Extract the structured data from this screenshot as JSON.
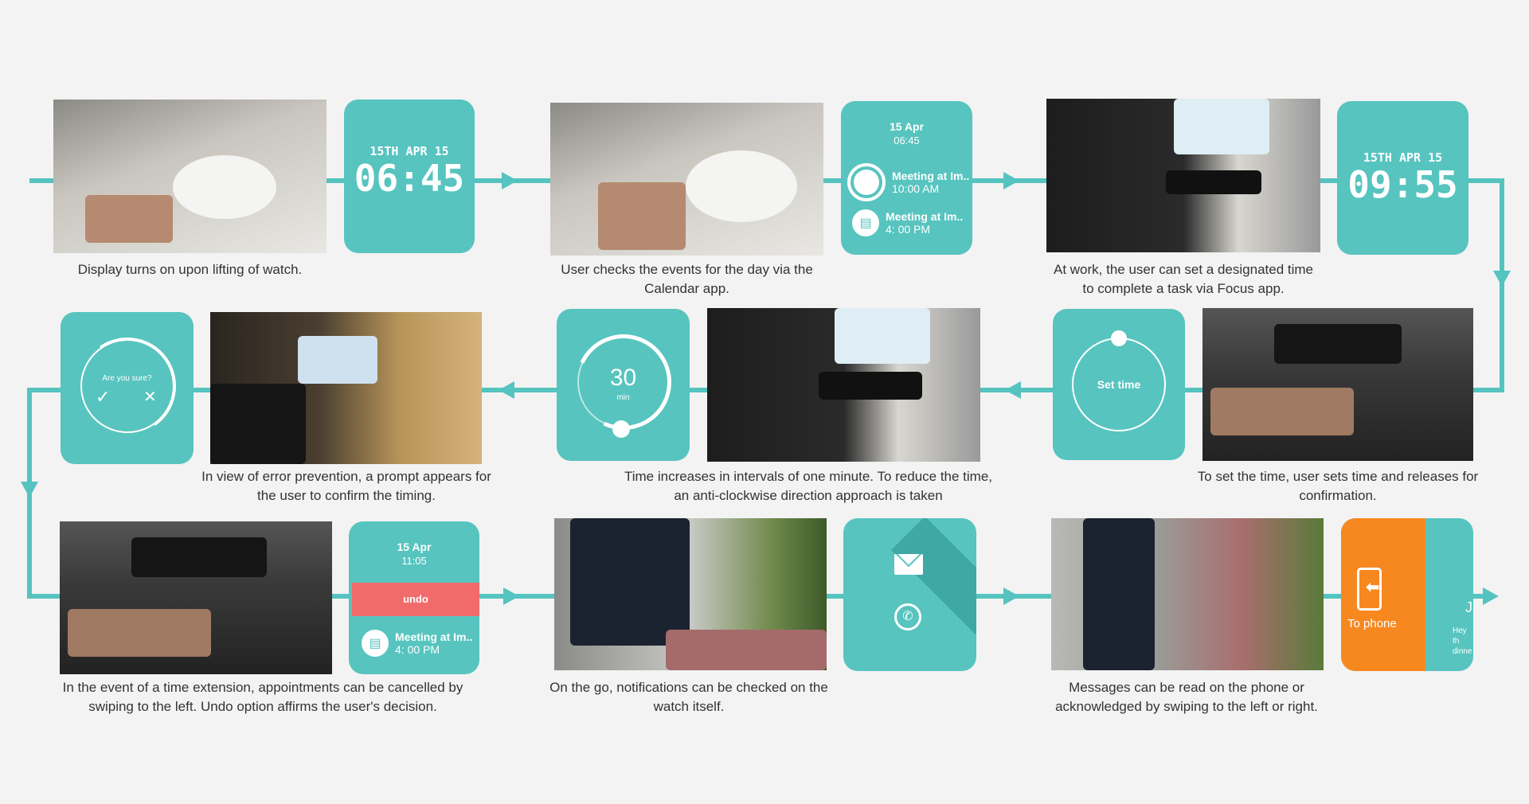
{
  "steps": [
    {
      "caption": "Display turns on upon lifting of watch.",
      "watch": {
        "date": "15TH APR 15",
        "time": "06:45"
      }
    },
    {
      "caption": "User checks the events for the day via the Calendar app.",
      "watch": {
        "date": "15 Apr",
        "time": "06:45",
        "events": [
          {
            "title": "Meeting at Im..",
            "time": "10:00 AM",
            "icon": "circle-icon"
          },
          {
            "title": "Meeting at Im..",
            "time": "4: 00 PM",
            "icon": "calendar-icon"
          }
        ]
      }
    },
    {
      "caption": "At work, the user can set a designated time to complete a task via Focus app.",
      "watch": {
        "date": "15TH APR 15",
        "time": "09:55"
      }
    },
    {
      "caption": "To set the time, user sets time and releases for confirmation.",
      "watch": {
        "label": "Set time"
      }
    },
    {
      "caption": "Time increases in intervals of one minute. To reduce the time, an anti-clockwise direction approach is taken",
      "watch": {
        "value": "30",
        "unit": "min"
      }
    },
    {
      "caption": "In view of error prevention, a prompt appears for the user to confirm the timing.",
      "watch": {
        "prompt": "Are you sure?",
        "confirm": "✓",
        "cancel": "✕"
      }
    },
    {
      "caption": "In the event of a time extension, appointments can be cancelled by swiping to the left. Undo option affirms the user's decision.",
      "watch": {
        "date": "15 Apr",
        "time": "11:05",
        "undo": "undo",
        "event": {
          "title": "Meeting at Im..",
          "time": "4: 00 PM"
        }
      }
    },
    {
      "caption": "On the go, notifications can be checked on the watch itself.",
      "watch": {
        "icons": [
          "mail-icon",
          "whatsapp-icon"
        ]
      }
    },
    {
      "caption": "Messages can be read on the phone or acknowledged by swiping to the left or right.",
      "watch": {
        "action": "To phone",
        "peek_name": "Ja",
        "peek_msg1": "Hey th",
        "peek_msg2": "dinne"
      }
    }
  ],
  "colors": {
    "teal": "#57c4bf",
    "orange": "#f7881f",
    "undo": "#f26b6b",
    "line": "#55c3bf"
  }
}
